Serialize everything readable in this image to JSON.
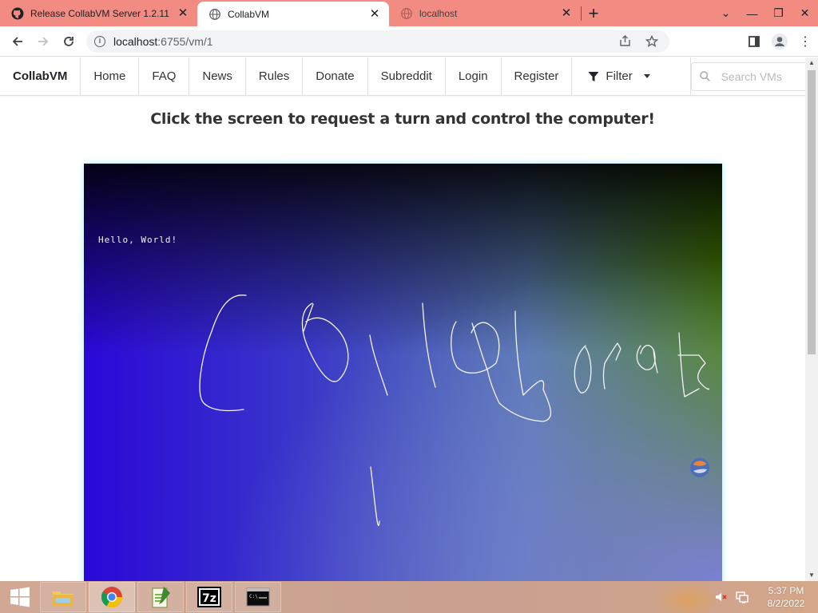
{
  "browser": {
    "tabs": [
      {
        "title": "Release CollabVM Server 1.2.11",
        "icon": "github-icon",
        "active": false
      },
      {
        "title": "CollabVM",
        "icon": "globe-icon",
        "active": true
      },
      {
        "title": "localhost",
        "icon": "globe-icon",
        "active": false
      }
    ],
    "address": {
      "host": "localhost",
      "path": ":6755/vm/1"
    }
  },
  "site": {
    "brand": "CollabVM",
    "nav": [
      "Home",
      "FAQ",
      "News",
      "Rules",
      "Donate",
      "Subreddit",
      "Login",
      "Register"
    ],
    "filter_label": "Filter",
    "search_placeholder": "Search VMs",
    "instructions": "Click the screen to request a turn and control the computer!"
  },
  "vm": {
    "desktop_text": "Hello, World!"
  },
  "taskbar": {
    "pinned": [
      "file-explorer-icon",
      "chrome-icon",
      "notepad-icon",
      "7zip-icon",
      "cmd-icon"
    ],
    "time": "5:37 PM",
    "date": "8/2/2022"
  },
  "colors": {
    "tabstrip": "#f28b82",
    "vm_blue": "#2a08d8",
    "vm_green": "#4a8a00"
  }
}
